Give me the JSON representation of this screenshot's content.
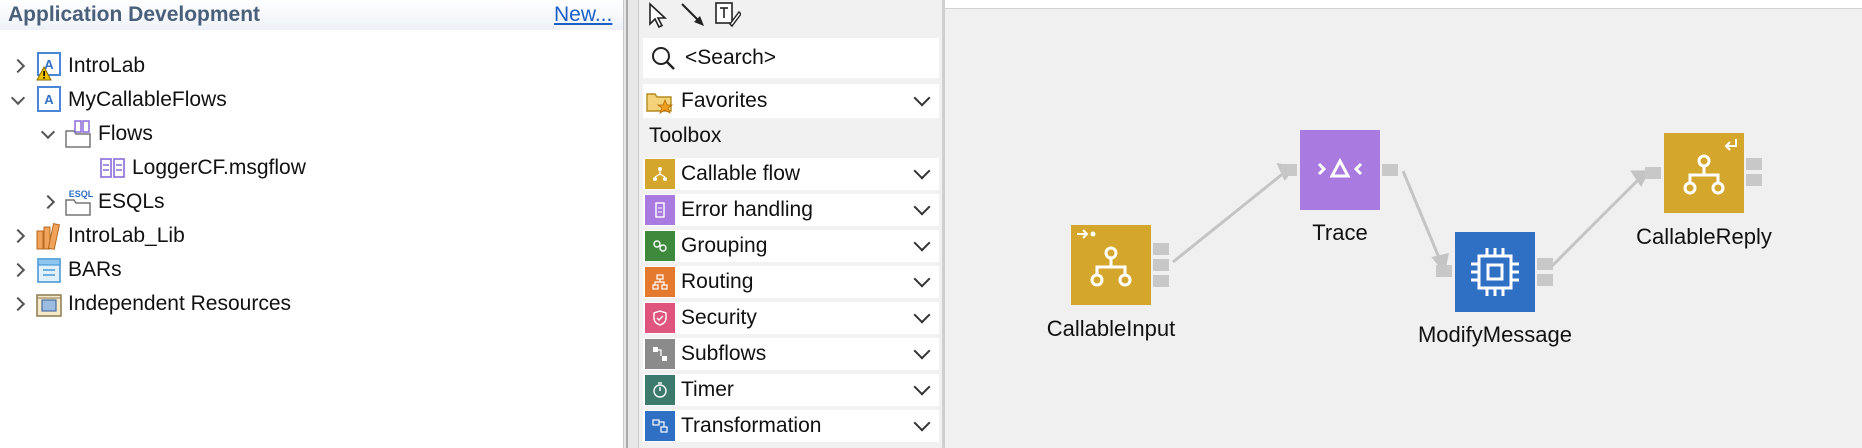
{
  "navigator": {
    "title": "Application Development",
    "new_link": "New...",
    "items": [
      {
        "label": "IntroLab"
      },
      {
        "label": "MyCallableFlows"
      },
      {
        "label": "Flows"
      },
      {
        "label": "LoggerCF.msgflow"
      },
      {
        "label": "ESQLs"
      },
      {
        "label": "IntroLab_Lib"
      },
      {
        "label": "BARs"
      },
      {
        "label": "Independent Resources"
      }
    ],
    "esql_badge": "ESQL"
  },
  "palette": {
    "search_placeholder": "<Search>",
    "favorites": "Favorites",
    "toolbox": "Toolbox",
    "drawers": [
      {
        "label": "Callable flow",
        "color": "#d4a72c"
      },
      {
        "label": "Error handling",
        "color": "#a97ae0"
      },
      {
        "label": "Grouping",
        "color": "#3d8a3d"
      },
      {
        "label": "Routing",
        "color": "#e57a2e"
      },
      {
        "label": "Security",
        "color": "#e0557e"
      },
      {
        "label": "Subflows",
        "color": "#8b8b8b"
      },
      {
        "label": "Timer",
        "color": "#3d7a6e"
      },
      {
        "label": "Transformation",
        "color": "#2f6fc4"
      }
    ]
  },
  "canvas": {
    "nodes": [
      {
        "label": "CallableInput",
        "color": "#d4a72c"
      },
      {
        "label": "Trace",
        "color": "#a97ae0"
      },
      {
        "label": "ModifyMessage",
        "color": "#2f6fc4"
      },
      {
        "label": "CallableReply",
        "color": "#d4a72c"
      }
    ]
  }
}
